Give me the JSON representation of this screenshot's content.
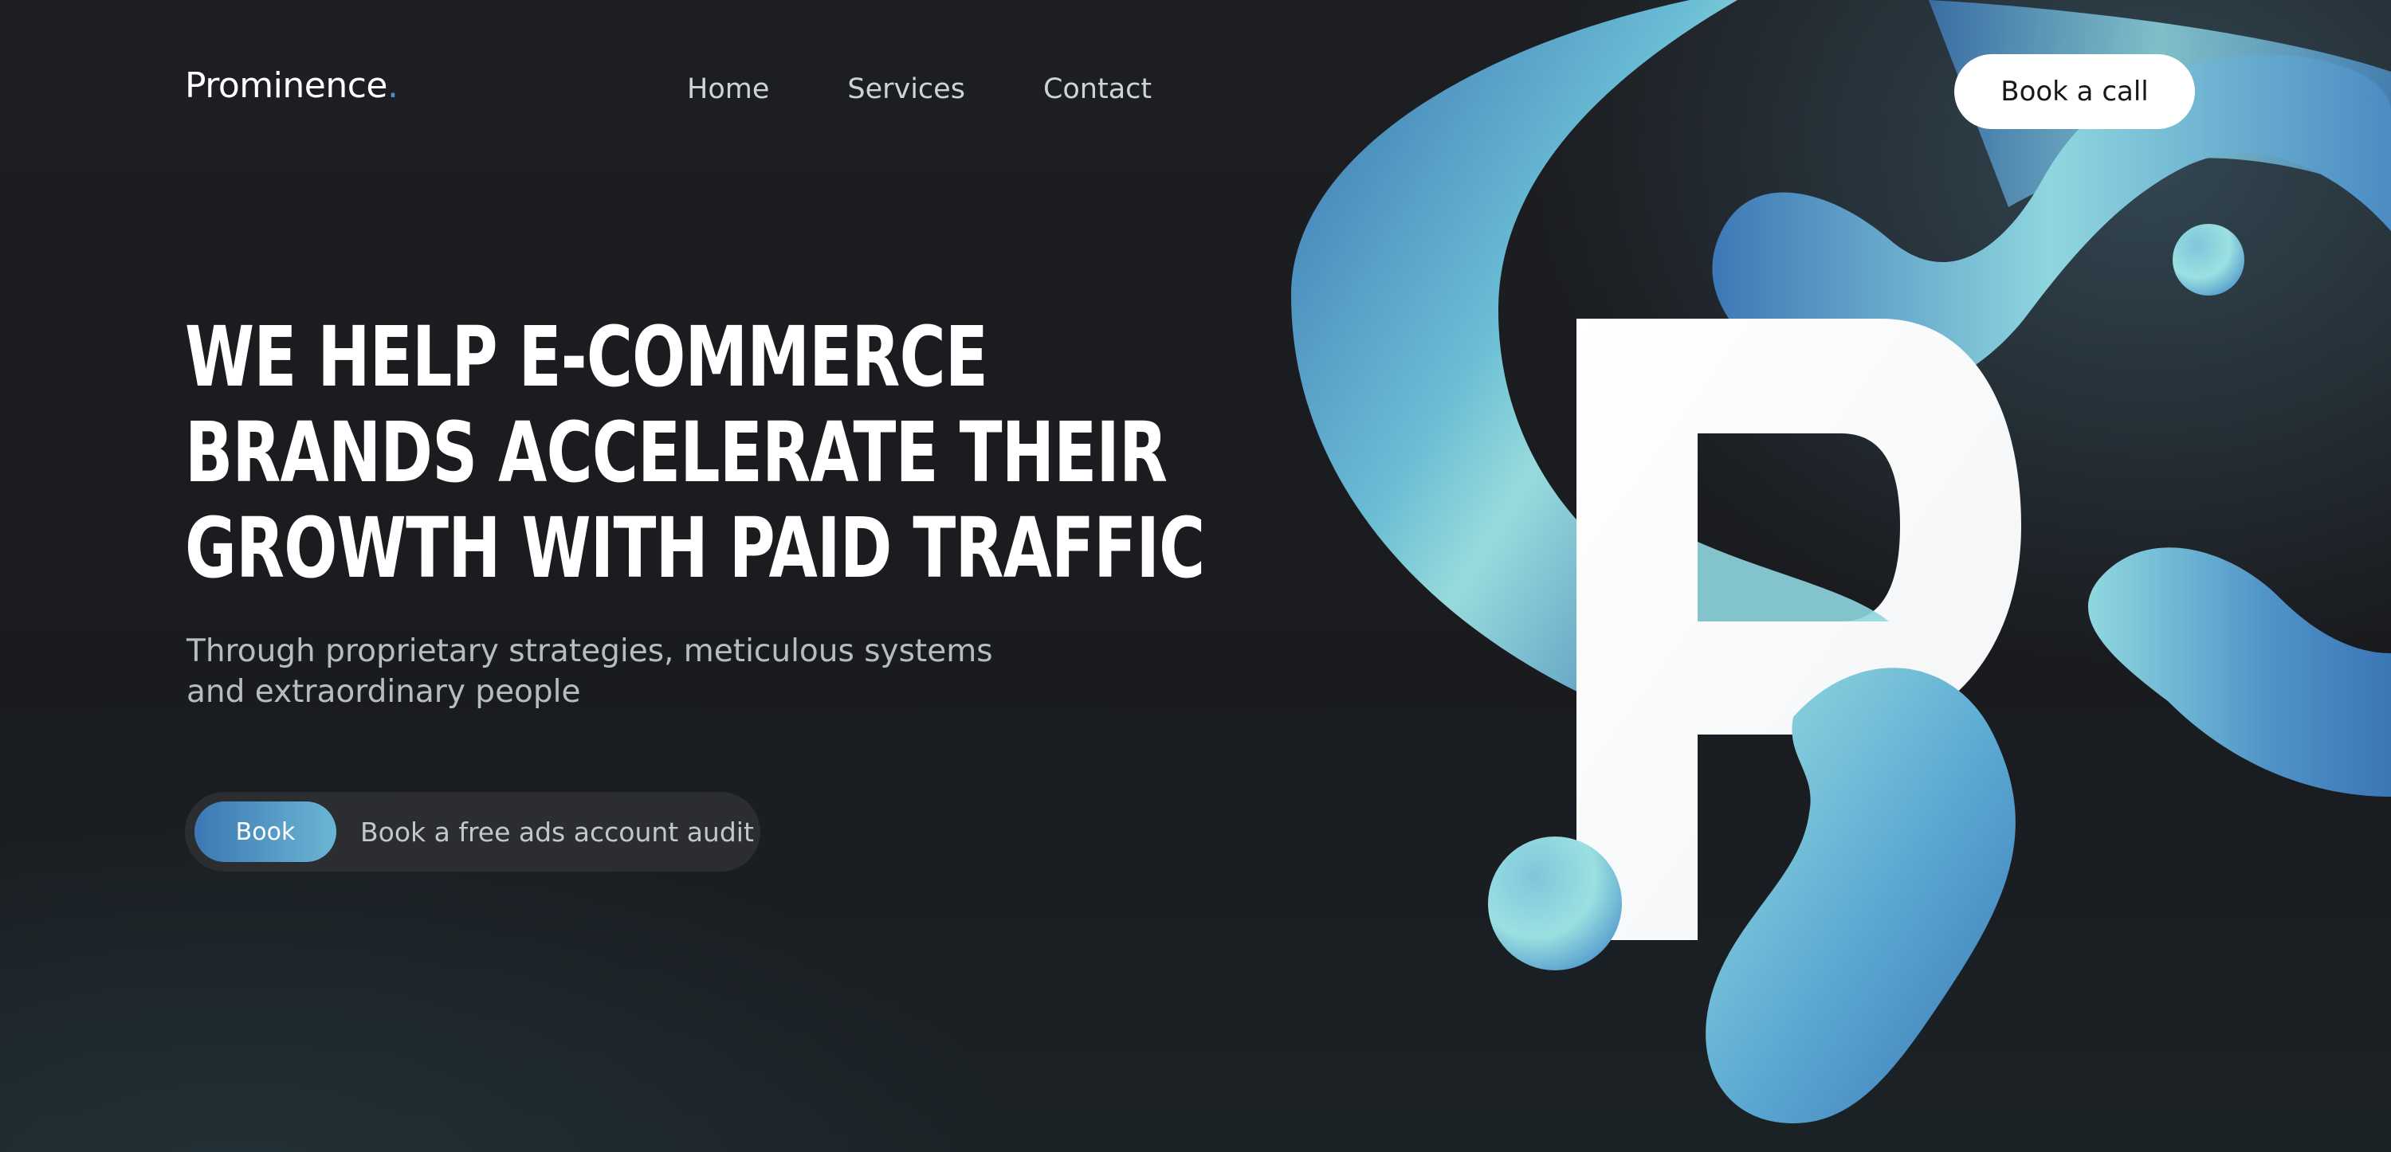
{
  "header": {
    "logo_text": "Prominence",
    "logo_dot": ".",
    "nav": [
      {
        "label": "Home"
      },
      {
        "label": "Services"
      },
      {
        "label": "Contact"
      }
    ],
    "cta_label": "Book a call"
  },
  "hero": {
    "headline_lines": [
      "WE HELP E-COMMERCE",
      "BRANDS ACCELERATE THEIR",
      "GROWTH WITH PAID TRAFFIC"
    ],
    "subheadline_lines": [
      "Through proprietary strategies, meticulous systems",
      "and extraordinary people"
    ],
    "audit_button_label": "Book",
    "audit_text": "Book a free ads account audit"
  },
  "colors": {
    "background": "#1b1d21",
    "accent_blue": "#3b78b3",
    "accent_cyan": "#94dbe0",
    "white": "#ffffff"
  },
  "icons": {
    "hero_art": "p-letter-with-blue-fluid-shapes"
  }
}
